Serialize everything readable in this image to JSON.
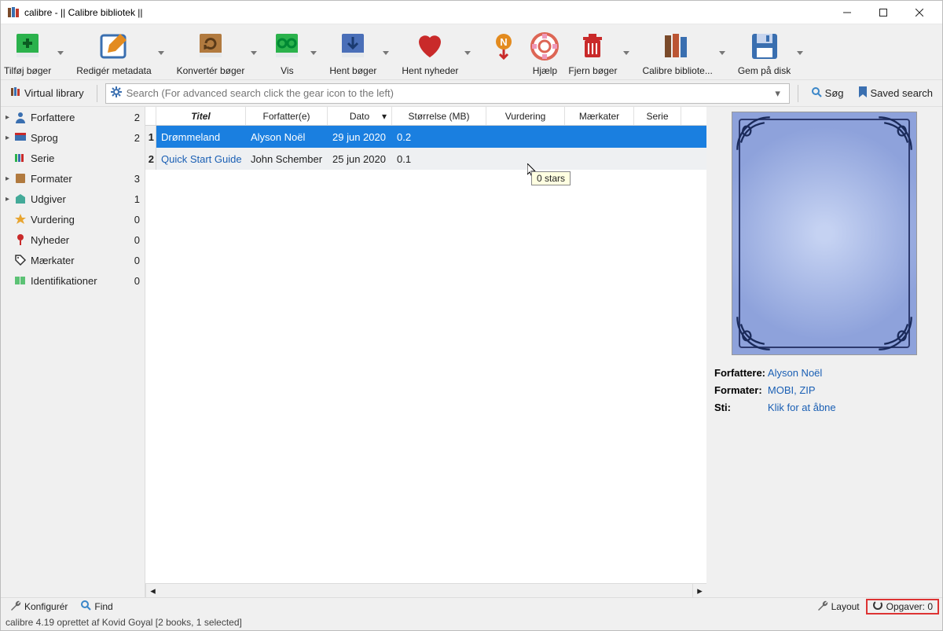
{
  "title": "calibre - || Calibre bibliotek ||",
  "toolbar": [
    {
      "label": "Tilføj bøger"
    },
    {
      "label": "Redigér metadata"
    },
    {
      "label": "Konvertér bøger"
    },
    {
      "label": "Vis"
    },
    {
      "label": "Hent bøger"
    },
    {
      "label": "Hent nyheder"
    },
    {
      "label": "Hjælp"
    },
    {
      "label": "Fjern bøger"
    },
    {
      "label": "Calibre bibliote..."
    },
    {
      "label": "Gem på disk"
    }
  ],
  "virtual_library": "Virtual library",
  "search": {
    "placeholder": "Search (For advanced search click the gear icon to the left)"
  },
  "search_btn": "Søg",
  "saved_search": "Saved search",
  "sidebar": [
    {
      "label": "Forfattere",
      "count": "2",
      "exp": true
    },
    {
      "label": "Sprog",
      "count": "2",
      "exp": true
    },
    {
      "label": "Serie",
      "count": "",
      "exp": false
    },
    {
      "label": "Formater",
      "count": "3",
      "exp": true
    },
    {
      "label": "Udgiver",
      "count": "1",
      "exp": true
    },
    {
      "label": "Vurdering",
      "count": "0",
      "exp": false
    },
    {
      "label": "Nyheder",
      "count": "0",
      "exp": false
    },
    {
      "label": "Mærkater",
      "count": "0",
      "exp": false
    },
    {
      "label": "Identifikationer",
      "count": "0",
      "exp": false
    }
  ],
  "columns": [
    "Titel",
    "Forfatter(e)",
    "Dato",
    "Størrelse (MB)",
    "Vurdering",
    "Mærkater",
    "Serie"
  ],
  "rows": [
    {
      "n": "1",
      "title": "Drømmeland",
      "author": "Alyson Noël",
      "date": "29 jun 2020",
      "size": "0.2",
      "rating": "",
      "tags": "",
      "series": ""
    },
    {
      "n": "2",
      "title": "Quick Start Guide",
      "author": "John Schember",
      "date": "25 jun 2020",
      "size": "0.1",
      "rating": "",
      "tags": "",
      "series": ""
    }
  ],
  "tooltip": "0 stars",
  "details": {
    "author_label": "Forfattere:",
    "author": "Alyson Noël",
    "formats_label": "Formater:",
    "formats": "MOBI, ZIP",
    "path_label": "Sti:",
    "path": "Klik for at åbne"
  },
  "status": {
    "config": "Konfigurér",
    "find": "Find",
    "layout": "Layout",
    "jobs": "Opgaver: 0"
  },
  "bottom": "calibre 4.19 oprettet af Kovid Goyal   [2 books, 1 selected]"
}
